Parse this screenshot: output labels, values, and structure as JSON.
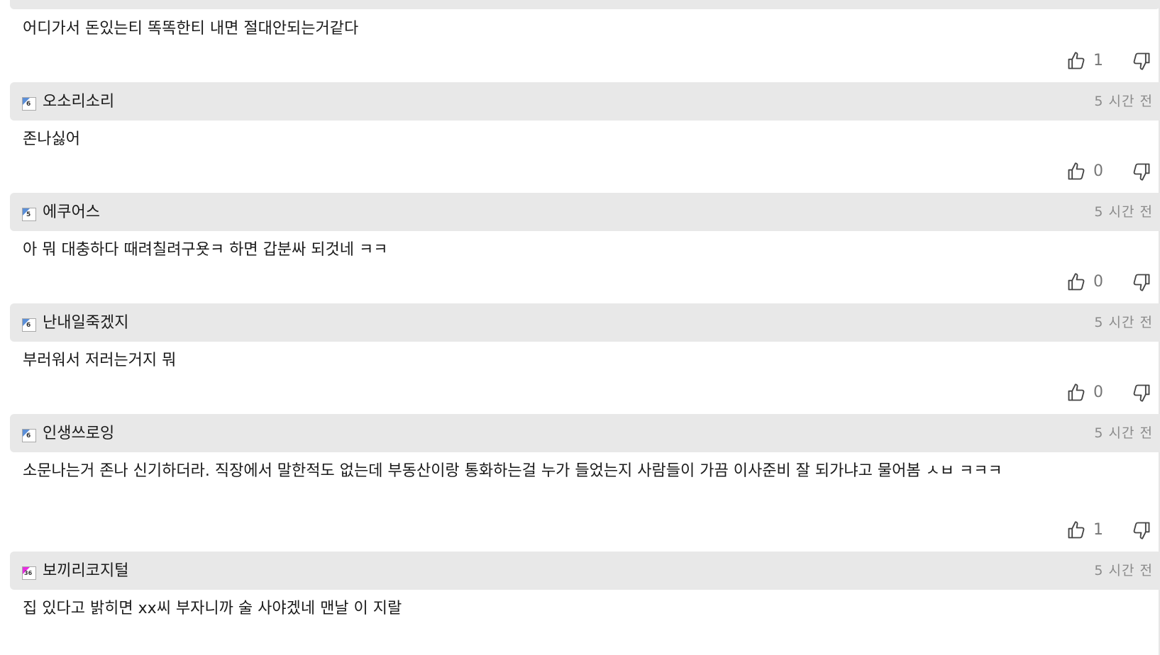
{
  "first_comment": {
    "body": "어디가서 돈있는티 똑똑한티 내면 절대안되는거같다",
    "likes": "1"
  },
  "comments": [
    {
      "nickname": "오소리소리",
      "level": "6",
      "time": "5 시간 전",
      "body": "존나싫어",
      "likes": "0"
    },
    {
      "nickname": "에쿠어스",
      "level": "5",
      "time": "5 시간 전",
      "body": "아 뭐 대충하다 때려칠려구욧ㅋ 하면 갑분싸 되것네 ㅋㅋ",
      "likes": "0"
    },
    {
      "nickname": "난내일죽겠지",
      "level": "6",
      "time": "5 시간 전",
      "body": "부러워서 저러는거지 뭐",
      "likes": "0"
    },
    {
      "nickname": "인생쓰로잉",
      "level": "6",
      "time": "5 시간 전",
      "body": "소문나는거 존나 신기하더라. 직장에서 말한적도 없는데 부동산이랑 통화하는걸 누가 들었는지 사람들이 가끔 이사준비 잘 되가냐고 물어봄 ㅅㅂ ㅋㅋㅋ",
      "likes": "1"
    },
    {
      "nickname": "보끼리코지털",
      "level": "36",
      "time": "5 시간 전",
      "body": "집 있다고 밝히면 xx씨 부자니까 술 사야겠네 맨날 이 지랄"
    }
  ],
  "icons": {
    "like": "thumbs-up-icon",
    "dislike": "thumbs-down-icon",
    "level": "level-badge-icon"
  },
  "colors": {
    "header_bg": "#e8e8e8",
    "level_blue": "#5b8fd8",
    "level_pink": "#e52de0",
    "time_text": "#8a8a8a"
  }
}
